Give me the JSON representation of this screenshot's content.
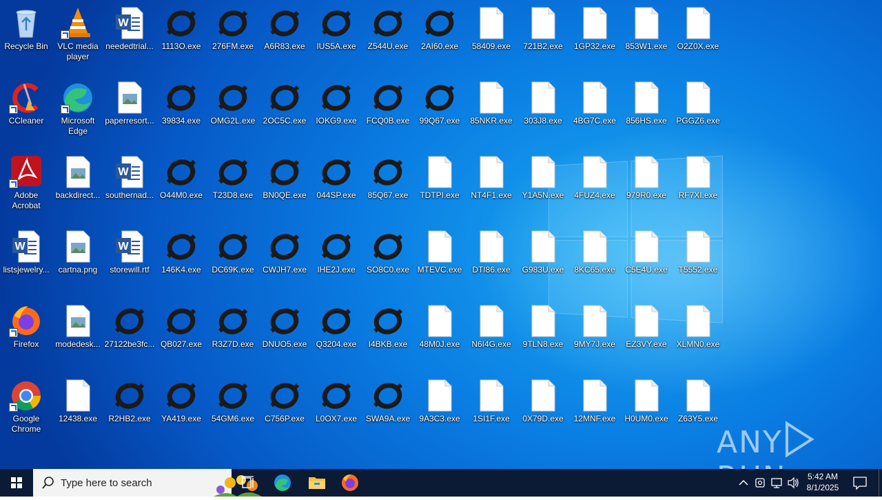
{
  "desktop": {
    "icons": [
      {
        "label": "Recycle Bin",
        "type": "recycle",
        "col": 0,
        "row": 0,
        "shortcut": false
      },
      {
        "label": "CCleaner",
        "type": "ccleaner",
        "col": 0,
        "row": 1,
        "shortcut": true
      },
      {
        "label": "Adobe Acrobat",
        "type": "acrobat",
        "col": 0,
        "row": 2,
        "shortcut": true
      },
      {
        "label": "listsjewelry...",
        "type": "word",
        "col": 0,
        "row": 3,
        "shortcut": false
      },
      {
        "label": "Firefox",
        "type": "firefox",
        "col": 0,
        "row": 4,
        "shortcut": true
      },
      {
        "label": "Google Chrome",
        "type": "chrome",
        "col": 0,
        "row": 5,
        "shortcut": true
      },
      {
        "label": "VLC media player",
        "type": "vlc",
        "col": 1,
        "row": 0,
        "shortcut": true
      },
      {
        "label": "Microsoft Edge",
        "type": "edge",
        "col": 1,
        "row": 1,
        "shortcut": true
      },
      {
        "label": "backdirect...",
        "type": "image",
        "col": 1,
        "row": 2,
        "shortcut": false
      },
      {
        "label": "cartna.png",
        "type": "image",
        "col": 1,
        "row": 3,
        "shortcut": false
      },
      {
        "label": "modedesk...",
        "type": "image",
        "col": 1,
        "row": 4,
        "shortcut": false
      },
      {
        "label": "12438.exe",
        "type": "blank",
        "col": 1,
        "row": 5,
        "shortcut": false
      },
      {
        "label": "neededtrial...",
        "type": "word",
        "col": 2,
        "row": 0,
        "shortcut": false
      },
      {
        "label": "paperresort...",
        "type": "image",
        "col": 2,
        "row": 1,
        "shortcut": false
      },
      {
        "label": "southernad...",
        "type": "word",
        "col": 2,
        "row": 2,
        "shortcut": false
      },
      {
        "label": "storewill.rtf",
        "type": "word",
        "col": 2,
        "row": 3,
        "shortcut": false
      },
      {
        "label": "27122be3fc...",
        "type": "ring",
        "col": 2,
        "row": 4,
        "shortcut": false
      },
      {
        "label": "R2HB2.exe",
        "type": "ring",
        "col": 2,
        "row": 5,
        "shortcut": false
      },
      {
        "label": "1113O.exe",
        "type": "ring",
        "col": 3,
        "row": 0,
        "shortcut": false
      },
      {
        "label": "39834.exe",
        "type": "ring",
        "col": 3,
        "row": 1,
        "shortcut": false
      },
      {
        "label": "O44M0.exe",
        "type": "ring",
        "col": 3,
        "row": 2,
        "shortcut": false
      },
      {
        "label": "146K4.exe",
        "type": "ring",
        "col": 3,
        "row": 3,
        "shortcut": false
      },
      {
        "label": "QB027.exe",
        "type": "ring",
        "col": 3,
        "row": 4,
        "shortcut": false
      },
      {
        "label": "YA419.exe",
        "type": "ring",
        "col": 3,
        "row": 5,
        "shortcut": false
      },
      {
        "label": "276FM.exe",
        "type": "ring",
        "col": 4,
        "row": 0,
        "shortcut": false
      },
      {
        "label": "OMG2L.exe",
        "type": "ring",
        "col": 4,
        "row": 1,
        "shortcut": false
      },
      {
        "label": "T23D8.exe",
        "type": "ring",
        "col": 4,
        "row": 2,
        "shortcut": false
      },
      {
        "label": "DC69K.exe",
        "type": "ring",
        "col": 4,
        "row": 3,
        "shortcut": false
      },
      {
        "label": "R3Z7D.exe",
        "type": "ring",
        "col": 4,
        "row": 4,
        "shortcut": false
      },
      {
        "label": "54GM6.exe",
        "type": "ring",
        "col": 4,
        "row": 5,
        "shortcut": false
      },
      {
        "label": "A6R83.exe",
        "type": "ring",
        "col": 5,
        "row": 0,
        "shortcut": false
      },
      {
        "label": "2OC5C.exe",
        "type": "ring",
        "col": 5,
        "row": 1,
        "shortcut": false
      },
      {
        "label": "BN0QE.exe",
        "type": "ring",
        "col": 5,
        "row": 2,
        "shortcut": false
      },
      {
        "label": "CWJH7.exe",
        "type": "ring",
        "col": 5,
        "row": 3,
        "shortcut": false
      },
      {
        "label": "DNUO5.exe",
        "type": "ring",
        "col": 5,
        "row": 4,
        "shortcut": false
      },
      {
        "label": "C756P.exe",
        "type": "ring",
        "col": 5,
        "row": 5,
        "shortcut": false
      },
      {
        "label": "IUS5A.exe",
        "type": "ring",
        "col": 6,
        "row": 0,
        "shortcut": false
      },
      {
        "label": "IOKG9.exe",
        "type": "ring",
        "col": 6,
        "row": 1,
        "shortcut": false
      },
      {
        "label": "044SP.exe",
        "type": "ring",
        "col": 6,
        "row": 2,
        "shortcut": false
      },
      {
        "label": "IHE2J.exe",
        "type": "ring",
        "col": 6,
        "row": 3,
        "shortcut": false
      },
      {
        "label": "Q3204.exe",
        "type": "ring",
        "col": 6,
        "row": 4,
        "shortcut": false
      },
      {
        "label": "L0OX7.exe",
        "type": "ring",
        "col": 6,
        "row": 5,
        "shortcut": false
      },
      {
        "label": "Z544U.exe",
        "type": "ring",
        "col": 7,
        "row": 0,
        "shortcut": false
      },
      {
        "label": "FCQ0B.exe",
        "type": "ring",
        "col": 7,
        "row": 1,
        "shortcut": false
      },
      {
        "label": "85Q67.exe",
        "type": "ring",
        "col": 7,
        "row": 2,
        "shortcut": false
      },
      {
        "label": "SO8C0.exe",
        "type": "ring",
        "col": 7,
        "row": 3,
        "shortcut": false
      },
      {
        "label": "I4BKB.exe",
        "type": "ring",
        "col": 7,
        "row": 4,
        "shortcut": false
      },
      {
        "label": "SWA9A.exe",
        "type": "ring",
        "col": 7,
        "row": 5,
        "shortcut": false
      },
      {
        "label": "2AI60.exe",
        "type": "ring",
        "col": 8,
        "row": 0,
        "shortcut": false
      },
      {
        "label": "99Q67.exe",
        "type": "ring",
        "col": 8,
        "row": 1,
        "shortcut": false
      },
      {
        "label": "TDTPI.exe",
        "type": "blank",
        "col": 8,
        "row": 2,
        "shortcut": false
      },
      {
        "label": "MTEVC.exe",
        "type": "blank",
        "col": 8,
        "row": 3,
        "shortcut": false
      },
      {
        "label": "48M0J.exe",
        "type": "blank",
        "col": 8,
        "row": 4,
        "shortcut": false
      },
      {
        "label": "9A3C3.exe",
        "type": "blank",
        "col": 8,
        "row": 5,
        "shortcut": false
      },
      {
        "label": "58409.exe",
        "type": "blank",
        "col": 9,
        "row": 0,
        "shortcut": false
      },
      {
        "label": "85NKR.exe",
        "type": "blank",
        "col": 9,
        "row": 1,
        "shortcut": false
      },
      {
        "label": "NT4F1.exe",
        "type": "blank",
        "col": 9,
        "row": 2,
        "shortcut": false
      },
      {
        "label": "DTI86.exe",
        "type": "blank",
        "col": 9,
        "row": 3,
        "shortcut": false
      },
      {
        "label": "N6I4G.exe",
        "type": "blank",
        "col": 9,
        "row": 4,
        "shortcut": false
      },
      {
        "label": "1SI1F.exe",
        "type": "blank",
        "col": 9,
        "row": 5,
        "shortcut": false
      },
      {
        "label": "721B2.exe",
        "type": "blank",
        "col": 10,
        "row": 0,
        "shortcut": false
      },
      {
        "label": "303J8.exe",
        "type": "blank",
        "col": 10,
        "row": 1,
        "shortcut": false
      },
      {
        "label": "Y1A5N.exe",
        "type": "blank",
        "col": 10,
        "row": 2,
        "shortcut": false
      },
      {
        "label": "G983U.exe",
        "type": "blank",
        "col": 10,
        "row": 3,
        "shortcut": false
      },
      {
        "label": "9TLN8.exe",
        "type": "blank",
        "col": 10,
        "row": 4,
        "shortcut": false
      },
      {
        "label": "0X79D.exe",
        "type": "blank",
        "col": 10,
        "row": 5,
        "shortcut": false
      },
      {
        "label": "1GP32.exe",
        "type": "blank",
        "col": 11,
        "row": 0,
        "shortcut": false
      },
      {
        "label": "4BG7C.exe",
        "type": "blank",
        "col": 11,
        "row": 1,
        "shortcut": false
      },
      {
        "label": "4FUZ4.exe",
        "type": "blank",
        "col": 11,
        "row": 2,
        "shortcut": false
      },
      {
        "label": "8KC65.exe",
        "type": "blank",
        "col": 11,
        "row": 3,
        "shortcut": false
      },
      {
        "label": "9MY7J.exe",
        "type": "blank",
        "col": 11,
        "row": 4,
        "shortcut": false
      },
      {
        "label": "12MNF.exe",
        "type": "blank",
        "col": 11,
        "row": 5,
        "shortcut": false
      },
      {
        "label": "853W1.exe",
        "type": "blank",
        "col": 12,
        "row": 0,
        "shortcut": false
      },
      {
        "label": "856HS.exe",
        "type": "blank",
        "col": 12,
        "row": 1,
        "shortcut": false
      },
      {
        "label": "979R0.exe",
        "type": "blank",
        "col": 12,
        "row": 2,
        "shortcut": false
      },
      {
        "label": "C5E4U.exe",
        "type": "blank",
        "col": 12,
        "row": 3,
        "shortcut": false
      },
      {
        "label": "EZ3VY.exe",
        "type": "blank",
        "col": 12,
        "row": 4,
        "shortcut": false
      },
      {
        "label": "H0UM0.exe",
        "type": "blank",
        "col": 12,
        "row": 5,
        "shortcut": false
      },
      {
        "label": "O2Z0X.exe",
        "type": "blank",
        "col": 13,
        "row": 0,
        "shortcut": false
      },
      {
        "label": "PGGZ6.exe",
        "type": "blank",
        "col": 13,
        "row": 1,
        "shortcut": false
      },
      {
        "label": "RF7XI.exe",
        "type": "blank",
        "col": 13,
        "row": 2,
        "shortcut": false
      },
      {
        "label": "T5552.exe",
        "type": "blank",
        "col": 13,
        "row": 3,
        "shortcut": false
      },
      {
        "label": "XLMN0.exe",
        "type": "blank",
        "col": 13,
        "row": 4,
        "shortcut": false
      },
      {
        "label": "Z63Y5.exe",
        "type": "blank",
        "col": 13,
        "row": 5,
        "shortcut": false
      }
    ]
  },
  "taskbar": {
    "search_placeholder": "Type here to search",
    "pinned": [
      "task-view-icon",
      "edge-icon",
      "file-explorer-icon",
      "firefox-icon"
    ],
    "clock_time": "5:42 AM",
    "clock_date": "8/1/2025"
  },
  "watermark": "ANY RUN",
  "colors": {
    "taskbar": "#0b1a35",
    "desktop": "#0a7ee3"
  }
}
